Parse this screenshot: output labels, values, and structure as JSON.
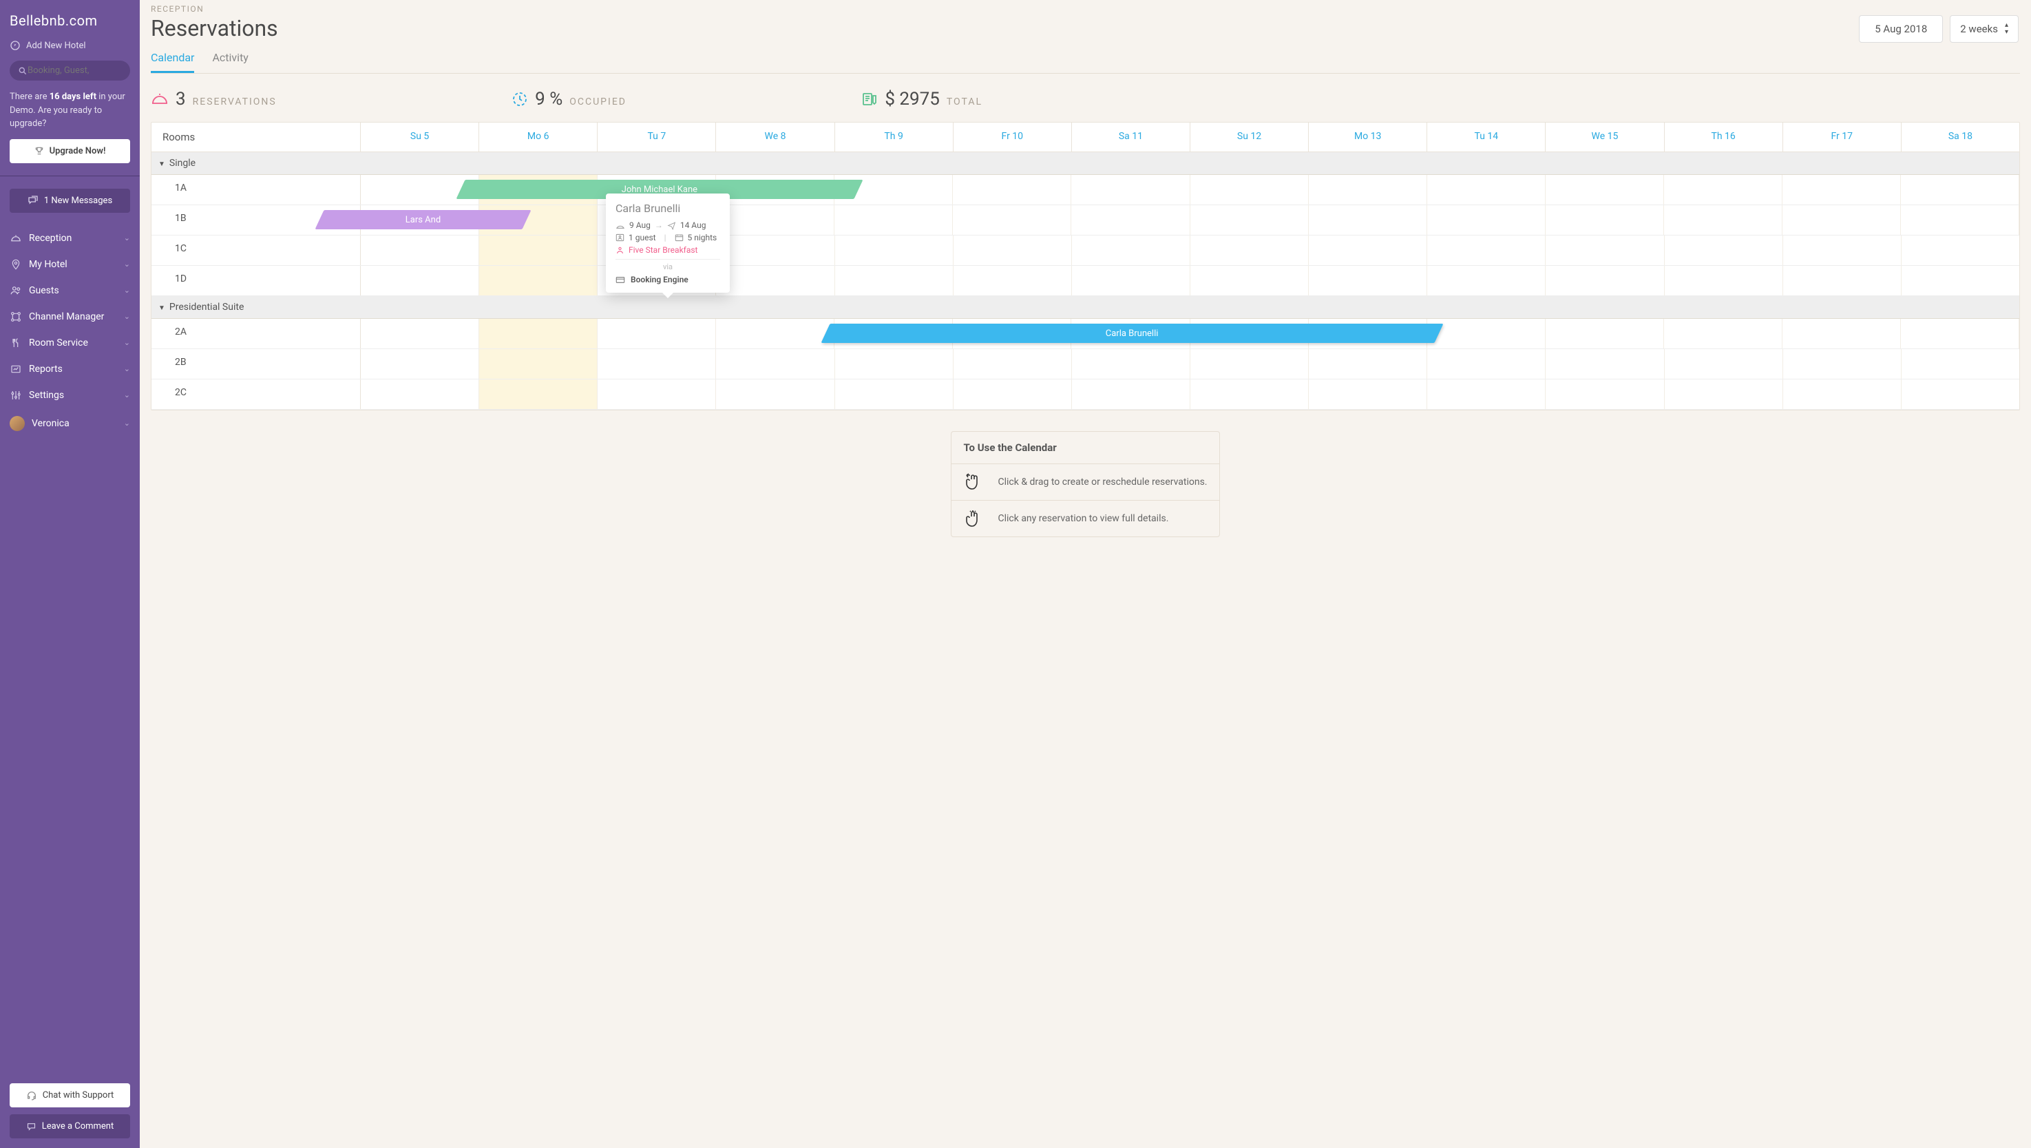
{
  "brand": "Bellebnb.com",
  "sidebar": {
    "add_hotel": "Add New Hotel",
    "search_placeholder": "Booking, Guest,",
    "demo_line1_prefix": "There are ",
    "demo_bold": "16 days left",
    "demo_line1_suffix": " in your Demo. Are you ready to upgrade?",
    "upgrade_label": "Upgrade Now!",
    "messages_label": "1 New Messages",
    "nav": [
      {
        "label": "Reception"
      },
      {
        "label": "My Hotel"
      },
      {
        "label": "Guests"
      },
      {
        "label": "Channel Manager"
      },
      {
        "label": "Room Service"
      },
      {
        "label": "Reports"
      },
      {
        "label": "Settings"
      }
    ],
    "user": "Veronica",
    "chat_label": "Chat with Support",
    "comment_label": "Leave a Comment"
  },
  "header": {
    "breadcrumb": "RECEPTION",
    "title": "Reservations",
    "date_picker": "5 Aug 2018",
    "range_picker": "2 weeks",
    "tabs": [
      {
        "label": "Calendar",
        "active": true
      },
      {
        "label": "Activity",
        "active": false
      }
    ]
  },
  "stats": {
    "reservations_num": "3",
    "reservations_label": "RESERVATIONS",
    "occupied_num": "9 %",
    "occupied_label": "OCCUPIED",
    "total_num": "$ 2975",
    "total_label": "TOTAL"
  },
  "calendar": {
    "rooms_header": "Rooms",
    "days": [
      "Su 5",
      "Mo 6",
      "Tu 7",
      "We 8",
      "Th 9",
      "Fr 10",
      "Sa 11",
      "Su 12",
      "Mo 13",
      "Tu 14",
      "We 15",
      "Th 16",
      "Fr 17",
      "Sa 18"
    ],
    "today_index": 1,
    "groups": [
      {
        "name": "Single",
        "rooms": [
          "1A",
          "1B",
          "1C",
          "1D"
        ]
      },
      {
        "name": "Presidential Suite",
        "rooms": [
          "2A",
          "2B",
          "2C"
        ]
      }
    ],
    "bookings": [
      {
        "guest": "John Michael Kane",
        "color": "b-green"
      },
      {
        "guest": "Lars And",
        "color": "b-purple"
      },
      {
        "guest": "Carla Brunelli",
        "color": "b-blue"
      }
    ]
  },
  "popup": {
    "name": "Carla Brunelli",
    "checkin": "9 Aug",
    "checkout": "14 Aug",
    "guests": "1 guest",
    "nights": "5 nights",
    "plan": "Five Star Breakfast",
    "via": "via",
    "source": "Booking Engine"
  },
  "tips": {
    "title": "To Use the Calendar",
    "rows": [
      "Click & drag to create or reschedule reservations.",
      "Click any reservation to view full details."
    ]
  }
}
